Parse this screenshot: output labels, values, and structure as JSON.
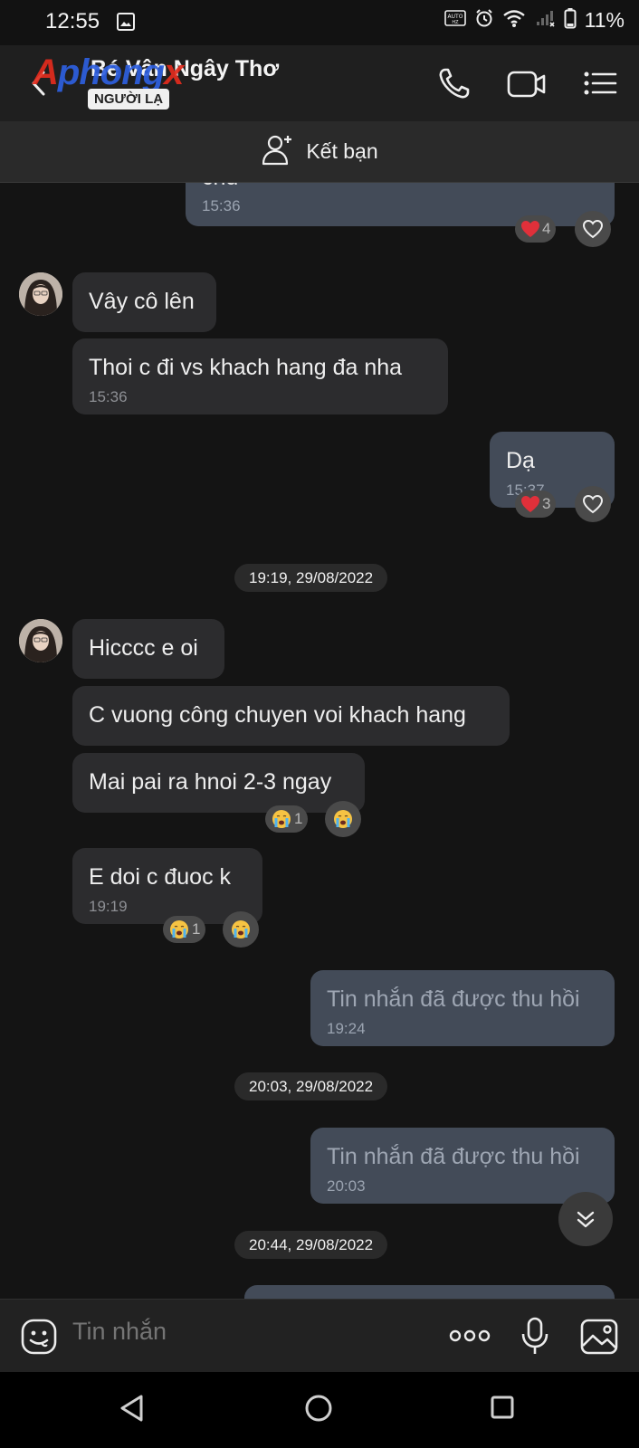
{
  "status_bar": {
    "time": "12:55",
    "battery": "11%",
    "icons": [
      "gallery-icon",
      "auto-hd-icon",
      "alarm-icon",
      "wifi-icon",
      "signal-icon",
      "battery-icon"
    ]
  },
  "header": {
    "contact_name": "Bé Vân Ngây Thơ",
    "badge": "NGƯỜI LẠ",
    "watermark": {
      "a": "A",
      "b": "phong",
      "c": "x"
    }
  },
  "friend_bar": {
    "label": "Kết bạn"
  },
  "messages": {
    "m0": {
      "text": "chu",
      "time": "15:36",
      "reaction_count": "4"
    },
    "m1": {
      "text": "Vây cô lên"
    },
    "m2": {
      "text": "Thoi c đi vs khach hang đa nha",
      "time": "15:36"
    },
    "m3": {
      "text": "Dạ",
      "time": "15:37",
      "reaction_count": "3"
    },
    "d1": "19:19, 29/08/2022",
    "m4": {
      "text": "Hicccc e oi"
    },
    "m5": {
      "text": "C vuong công chuyen voi khach hang"
    },
    "m6": {
      "text": "Mai pai ra hnoi 2-3 ngay",
      "reaction_count": "1"
    },
    "m7": {
      "text": "E doi c đuoc k",
      "time": "19:19",
      "reaction_count": "1"
    },
    "m8": {
      "text": "Tin nhắn đã được thu hồi",
      "time": "19:24"
    },
    "d2": "20:03, 29/08/2022",
    "m9": {
      "text": "Tin nhắn đã được thu hồi",
      "time": "20:03"
    },
    "d3": "20:44, 29/08/2022"
  },
  "input": {
    "placeholder": "Tin nhắn"
  },
  "colors": {
    "incoming": "#2c2c2e",
    "outgoing": "#434b58",
    "background": "#141414",
    "heart": "#e0303a"
  }
}
